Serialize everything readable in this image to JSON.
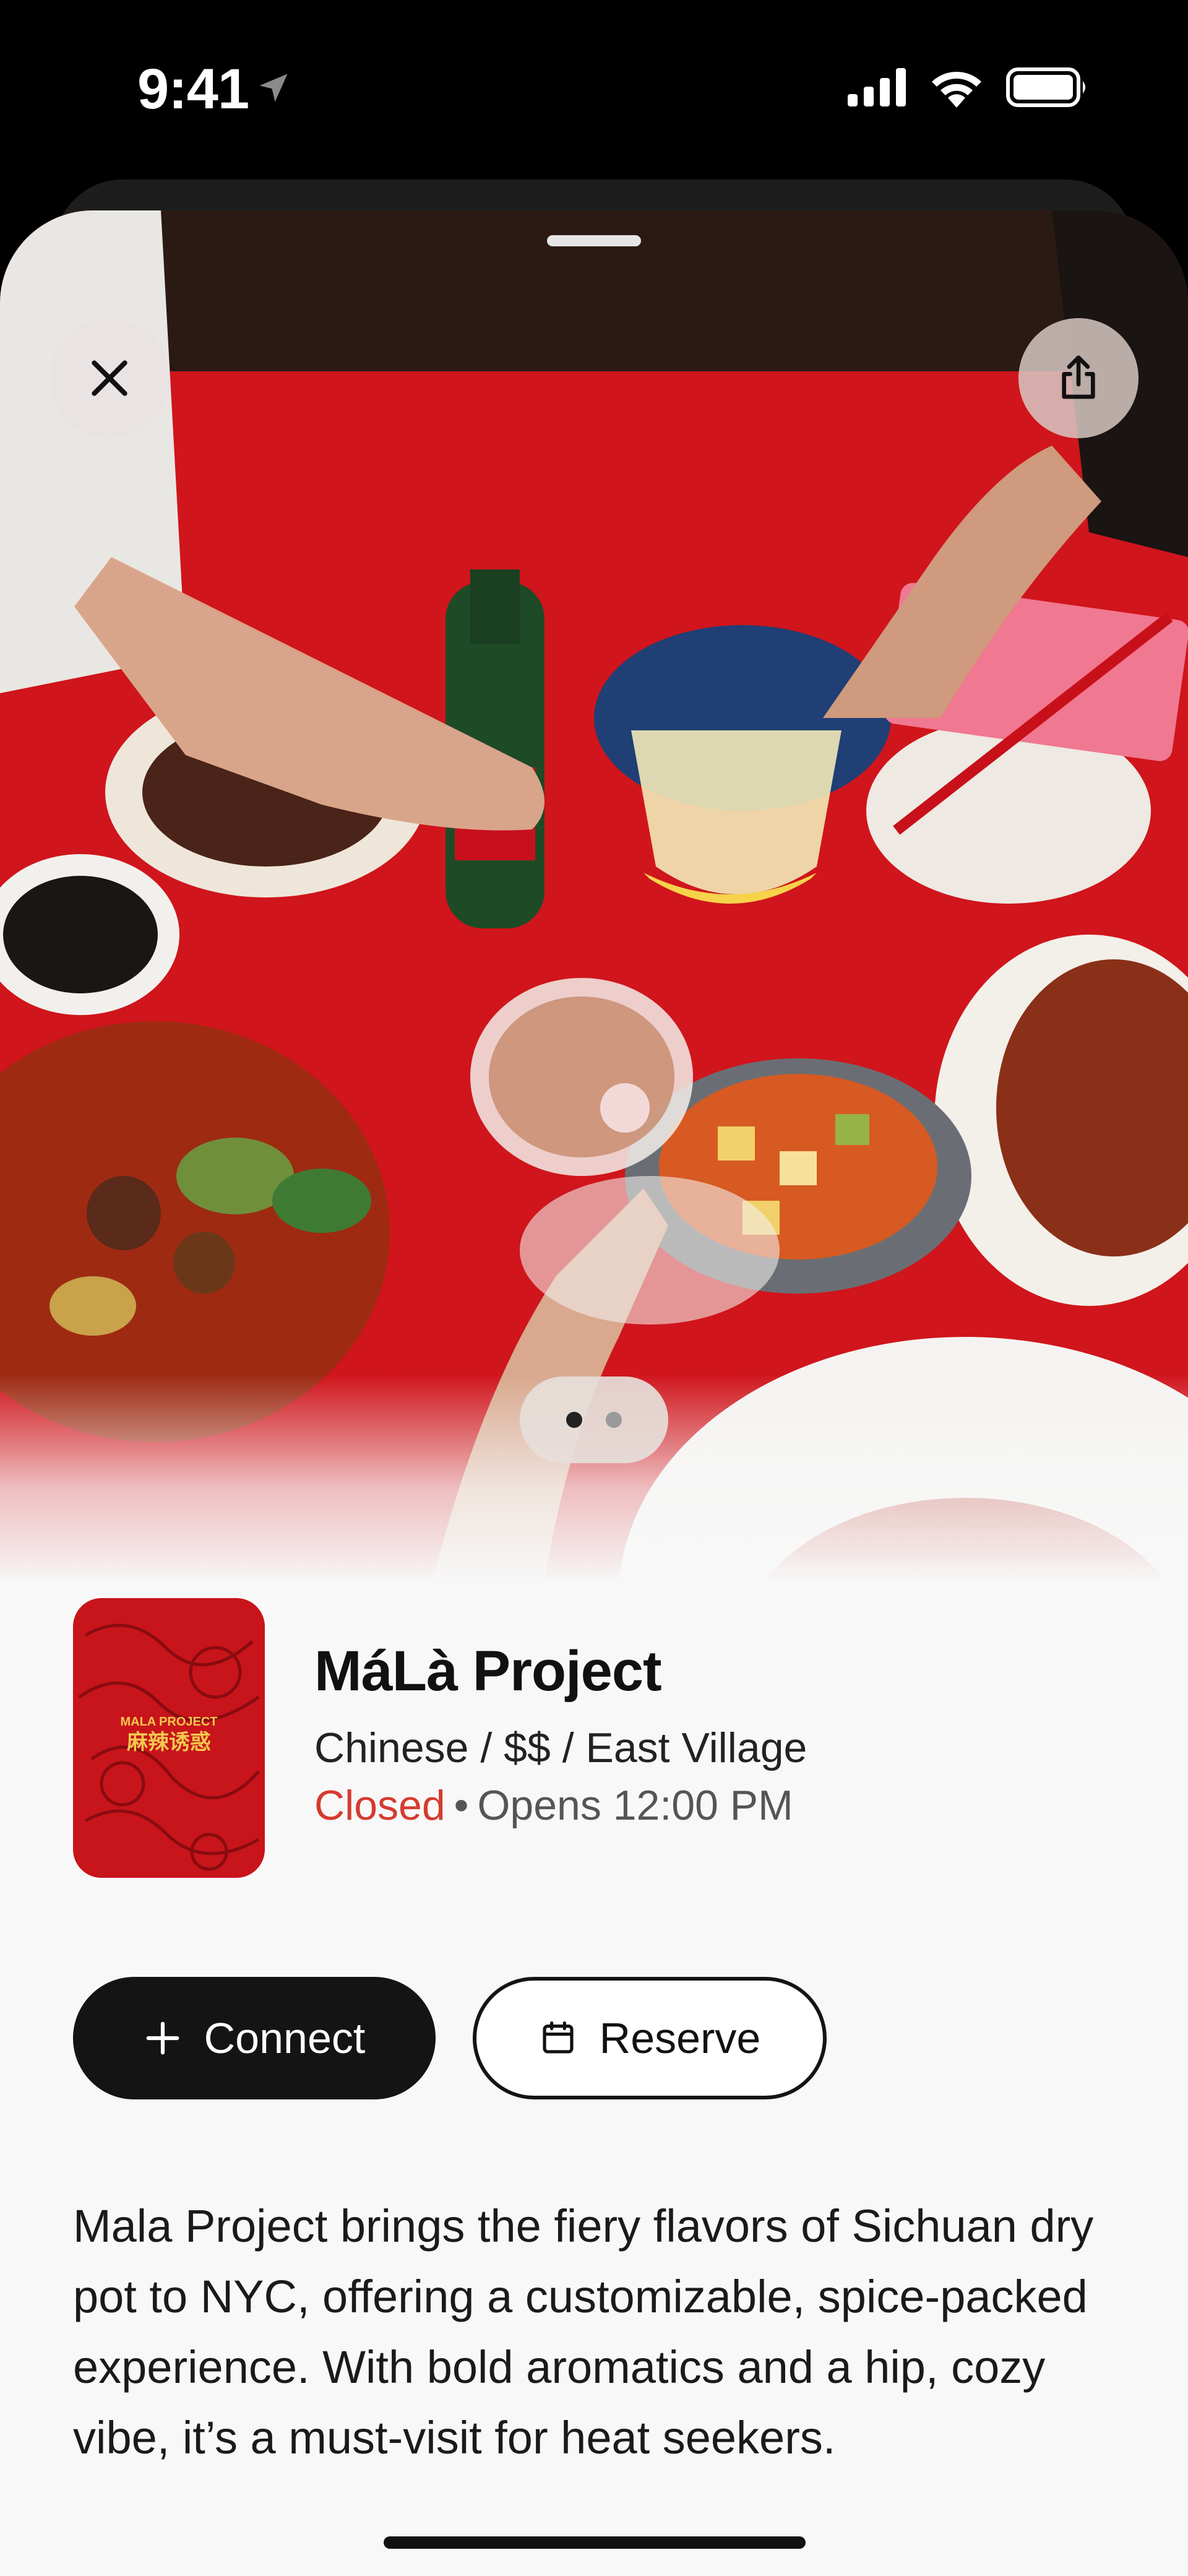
{
  "status_bar": {
    "time": "9:41",
    "icons": [
      "location-arrow-icon",
      "cellular-signal-icon",
      "wifi-icon",
      "battery-icon"
    ]
  },
  "hero": {
    "close_icon": "close-icon",
    "share_icon": "share-icon",
    "page_count": 2,
    "active_page": 1
  },
  "restaurant": {
    "name": "MáLà Project",
    "subtitle": "Chinese / $$ / East Village",
    "status": "Closed",
    "status_separator": "•",
    "opens": "Opens 12:00 PM",
    "logo_text": "MALA PROJECT",
    "logo_text_cn": "麻辣诱惑",
    "status_color": "#d63a2f"
  },
  "actions": {
    "connect_label": "Connect",
    "connect_icon": "plus-icon",
    "reserve_label": "Reserve",
    "reserve_icon": "calendar-icon"
  },
  "description": "Mala Project brings the fiery flavors of Sichuan dry pot to NYC, offering a customizable, spice-packed experience. With bold aromatics and a hip, cozy vibe, it’s a must-visit for heat seekers."
}
